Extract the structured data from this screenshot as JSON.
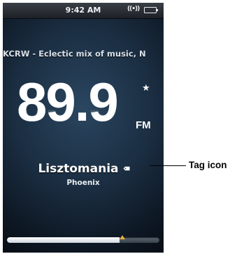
{
  "status_bar": {
    "time": "9:42 AM",
    "broadcast_indicator": "((•))",
    "battery_icon": "battery-full-icon"
  },
  "radio": {
    "station_description": "KCRW - Eclectic mix of music, N",
    "frequency": "89.9",
    "band": "FM",
    "favorite_icon": "star-icon",
    "song_title": "Lisztomania",
    "artist": "Phoenix",
    "tag_icon": "tag-icon",
    "tuner_position": 0.74
  },
  "callout": {
    "label": "Tag icon"
  },
  "colors": {
    "screen_background": "#1b2e42",
    "text": "#ffffff",
    "tuner_thumb": "#e2b03d",
    "callout_text": "#000000"
  }
}
